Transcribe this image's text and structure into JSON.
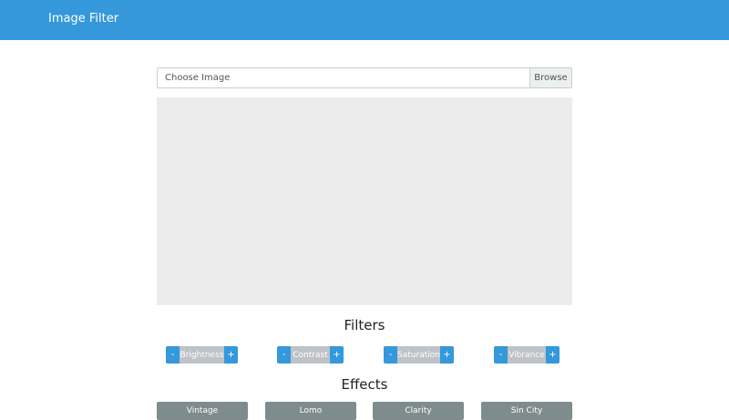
{
  "navbar": {
    "brand": "Image Filter"
  },
  "file_picker": {
    "placeholder": "Choose Image",
    "browse_label": "Browse"
  },
  "filters": {
    "title": "Filters",
    "items": [
      {
        "minus": "-",
        "label": "Brightness",
        "plus": "+"
      },
      {
        "minus": "-",
        "label": "Contrast",
        "plus": "+"
      },
      {
        "minus": "-",
        "label": "Saturation",
        "plus": "+"
      },
      {
        "minus": "-",
        "label": "Vibrance",
        "plus": "+"
      }
    ]
  },
  "effects": {
    "title": "Effects",
    "items": [
      "Vintage",
      "Lomo",
      "Clarity",
      "Sin City"
    ]
  },
  "colors": {
    "primary": "#3498db",
    "filter_label_bg": "#bdc3c7",
    "effect_button_bg": "#7f8c8d",
    "canvas_bg": "#ececec"
  }
}
